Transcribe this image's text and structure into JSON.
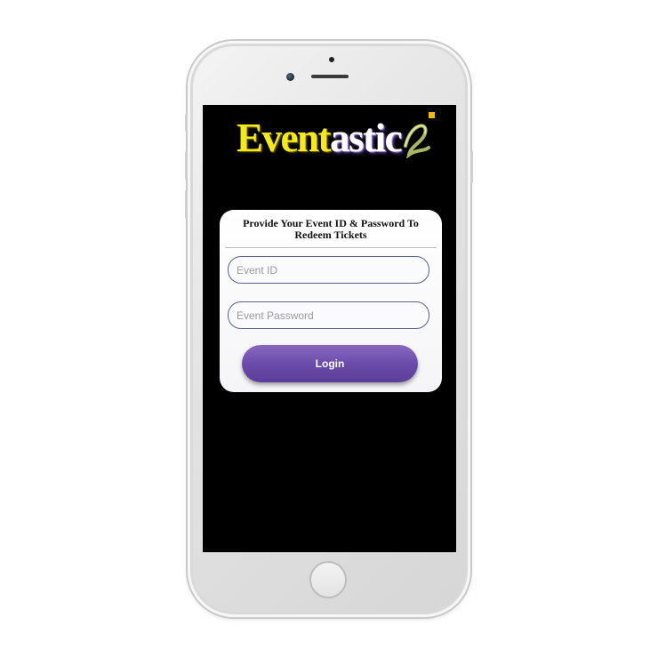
{
  "app": {
    "logo": {
      "part1": "Event",
      "part2": "astic"
    }
  },
  "login_card": {
    "title": "Provide Your Event ID & Password To Redeem Tickets",
    "event_id": {
      "value": "",
      "placeholder": "Event ID"
    },
    "event_password": {
      "value": "",
      "placeholder": "Event Password"
    },
    "login_label": "Login"
  },
  "colors": {
    "logo_yellow": "#f4ea1a",
    "accent_purple": "#6a4aa8",
    "logo_square": "#f5b800",
    "screen_bg": "#000000"
  },
  "icons": [
    "swirl-logo-icon"
  ]
}
